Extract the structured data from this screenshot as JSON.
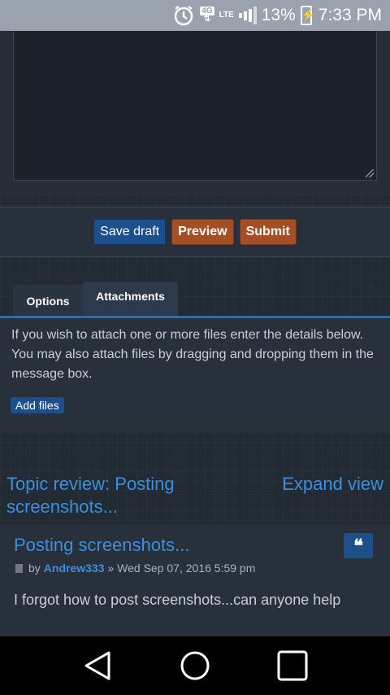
{
  "status_bar": {
    "network_type": "4G",
    "lte": "LTE",
    "battery": "13%",
    "time": "7:33 PM",
    "icons": [
      "alarm-icon",
      "signal-icon",
      "battery-charging-icon"
    ]
  },
  "actions": {
    "save_draft": "Save draft",
    "preview": "Preview",
    "submit": "Submit"
  },
  "tabs": [
    {
      "label": "Options"
    },
    {
      "label": "Attachments"
    }
  ],
  "attachments": {
    "instructions": "If you wish to attach one or more files enter the details below. You may also attach files by dragging and dropping them in the message box.",
    "add_files": "Add files"
  },
  "topic_review": {
    "title": "Topic review: Posting screenshots...",
    "expand": "Expand view"
  },
  "post": {
    "title": "Posting screenshots...",
    "by": "by",
    "author": "Andrew333",
    "date": "» Wed Sep 07, 2016 5:59 pm",
    "body": "I forgot how to post screenshots...can anyone help"
  },
  "colors": {
    "link": "#3d8ee0",
    "button_blue": "#1c4f8c",
    "button_orange": "#a44e26"
  }
}
